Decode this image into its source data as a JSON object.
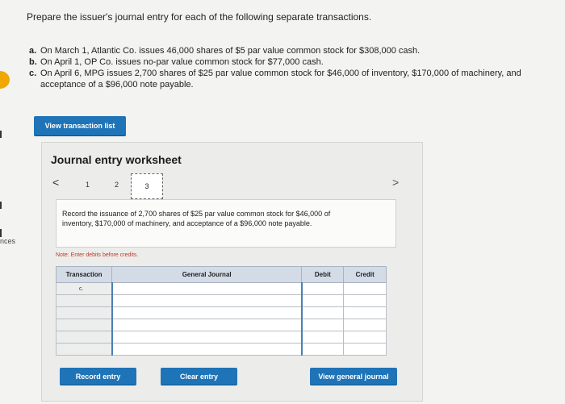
{
  "heading": "Prepare the issuer's journal entry for each of the following separate transactions.",
  "transactions": [
    {
      "label": "a.",
      "text": "On March 1, Atlantic Co. issues 46,000 shares of $5 par value common stock for $308,000 cash."
    },
    {
      "label": "b.",
      "text": "On April 1, OP Co. issues no-par value common stock for $77,000 cash."
    },
    {
      "label": "c.",
      "text": "On April 6, MPG issues 2,700 shares of $25 par value common stock for $46,000 of inventory, $170,000 of machinery, and acceptance of a $96,000 note payable."
    }
  ],
  "left_margin_text": "nces",
  "buttons": {
    "view_transaction_list": "View transaction list",
    "record_entry": "Record entry",
    "clear_entry": "Clear entry",
    "view_general_journal": "View general journal"
  },
  "worksheet": {
    "title": "Journal entry worksheet",
    "nav_prev": "<",
    "nav_next": ">",
    "pages": [
      "1",
      "2",
      "3"
    ],
    "active_page": "3",
    "instruction": "Record the issuance of 2,700 shares of $25 par value common stock for $46,000 of inventory, $170,000 of machinery, and acceptance of a $96,000 note payable.",
    "note": "Note: Enter debits before credits.",
    "table": {
      "headers": {
        "transaction": "Transaction",
        "general_journal": "General Journal",
        "debit": "Debit",
        "credit": "Credit"
      },
      "rows": [
        {
          "transaction": "c.",
          "account": "",
          "debit": "",
          "credit": ""
        },
        {
          "transaction": "",
          "account": "",
          "debit": "",
          "credit": ""
        },
        {
          "transaction": "",
          "account": "",
          "debit": "",
          "credit": ""
        },
        {
          "transaction": "",
          "account": "",
          "debit": "",
          "credit": ""
        },
        {
          "transaction": "",
          "account": "",
          "debit": "",
          "credit": ""
        },
        {
          "transaction": "",
          "account": "",
          "debit": "",
          "credit": ""
        }
      ]
    }
  },
  "colors": {
    "accent": "#1f74b8",
    "header_fill": "#d2dbe6",
    "note_red": "#c0392b",
    "marker": "#f0a800"
  }
}
